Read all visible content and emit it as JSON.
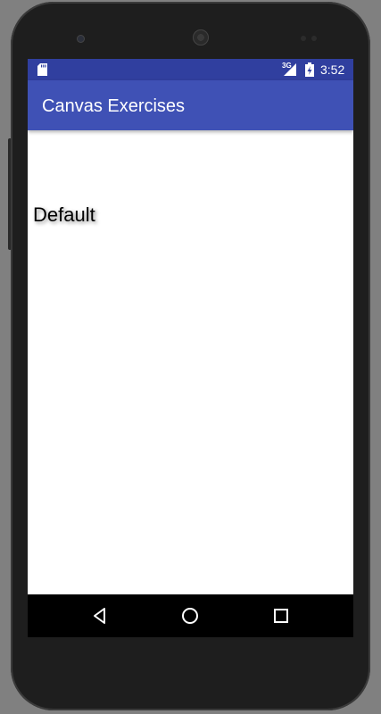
{
  "status_bar": {
    "network": "3G",
    "time": "3:52"
  },
  "app_bar": {
    "title": "Canvas Exercises"
  },
  "content": {
    "text": "Default"
  },
  "colors": {
    "status_bar": "#303f9f",
    "app_bar": "#3f51b5",
    "nav_bar": "#000000",
    "content_bg": "#ffffff"
  },
  "nav_bar": {
    "icons": [
      "back-icon",
      "home-icon",
      "recents-icon"
    ]
  }
}
